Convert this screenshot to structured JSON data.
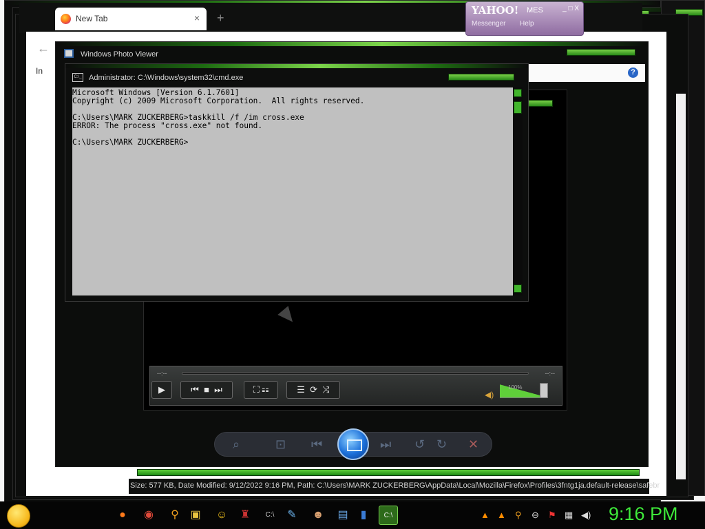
{
  "browser": {
    "tab_title": "New Tab",
    "tab_close": "×",
    "new_tab": "+",
    "back": "←",
    "import_label": "In"
  },
  "yahoo": {
    "title": "YAHOO!",
    "title_suffix": "MES",
    "menu_messenger": "Messenger",
    "menu_help": "Help",
    "controls": "_ □ X"
  },
  "photo_viewer": {
    "title": "Windows Photo Viewer",
    "help": "?",
    "status": "Size: 577 KB, Date Modified: 9/12/2022 9:16 PM, Path: C:\\Users\\MARK ZUCKERBERG\\AppData\\Local\\Mozilla\\Firefox\\Profiles\\3fntg1ja.default-release\\safebr"
  },
  "player": {
    "time_elapsed": "--:--",
    "time_total": "--:--",
    "volume_pct": "100%",
    "volume_level": 1.0
  },
  "cmd": {
    "title": "Administrator: C:\\Windows\\system32\\cmd.exe",
    "icon_text": "C:\\_",
    "output": "Microsoft Windows [Version 6.1.7601]\nCopyright (c) 2009 Microsoft Corporation.  All rights reserved.\n\nC:\\Users\\MARK ZUCKERBERG>taskkill /f /im cross.exe\nERROR: The process \"cross.exe\" not found.\n\nC:\\Users\\MARK ZUCKERBERG>"
  },
  "taskbar": {
    "clock": "9:16 PM",
    "apps": [
      "firefox-icon",
      "chrome-icon",
      "search-icon",
      "folder-icon",
      "messenger-icon",
      "game-icon",
      "cmd-icon",
      "paint-icon",
      "viewer-icon",
      "photo-viewer-icon",
      "book-icon",
      "cmd-active-icon"
    ],
    "tray": [
      "vlc-icon",
      "vlc-icon",
      "search-icon",
      "stop-icon",
      "flag-icon",
      "network-icon",
      "volume-icon"
    ]
  }
}
